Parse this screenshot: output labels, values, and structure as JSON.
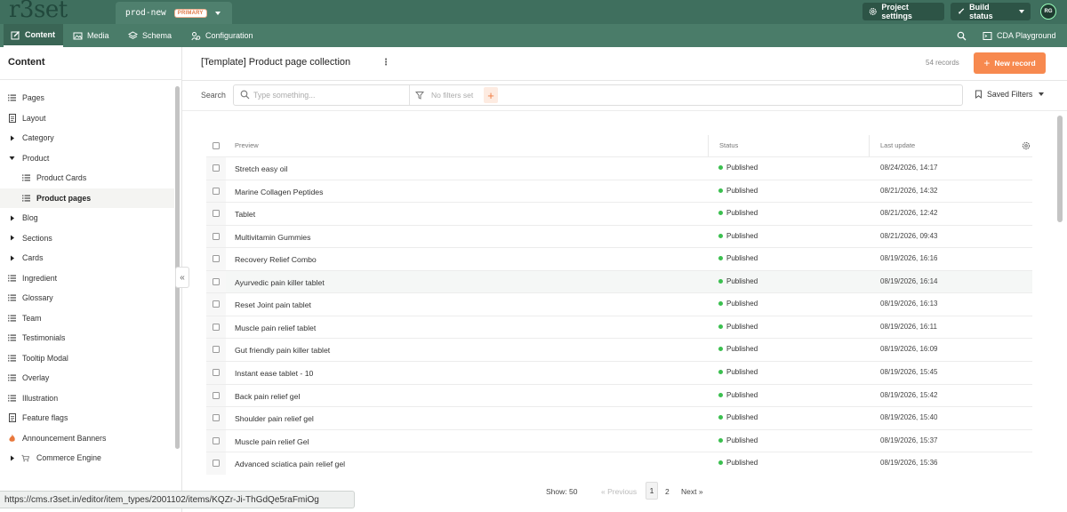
{
  "topbar": {
    "logo": "r3set",
    "environment": "prod-new",
    "environment_badge": "PRIMARY",
    "project_settings": "Project settings",
    "build_status": "Build status",
    "avatar_initials": "RG"
  },
  "nav": {
    "content": "Content",
    "media": "Media",
    "schema": "Schema",
    "configuration": "Configuration",
    "cda_playground": "CDA Playground"
  },
  "sidebar": {
    "title": "Content",
    "items": [
      {
        "label": "Pages",
        "icon": "list-icon",
        "indent": 0
      },
      {
        "label": "Layout",
        "icon": "document-icon",
        "indent": 0
      },
      {
        "label": "Category",
        "icon": "caret-right-icon",
        "indent": 0
      },
      {
        "label": "Product",
        "icon": "caret-down-icon",
        "indent": 0
      },
      {
        "label": "Product Cards",
        "icon": "list-icon",
        "indent": 1
      },
      {
        "label": "Product pages",
        "icon": "list-icon",
        "indent": 1,
        "active": true
      },
      {
        "label": "Blog",
        "icon": "caret-right-icon",
        "indent": 0
      },
      {
        "label": "Sections",
        "icon": "caret-right-icon",
        "indent": 0
      },
      {
        "label": "Cards",
        "icon": "caret-right-icon",
        "indent": 0
      },
      {
        "label": "Ingredient",
        "icon": "list-icon",
        "indent": 0
      },
      {
        "label": "Glossary",
        "icon": "list-icon",
        "indent": 0
      },
      {
        "label": "Team",
        "icon": "list-icon",
        "indent": 0
      },
      {
        "label": "Testimonials",
        "icon": "list-icon",
        "indent": 0
      },
      {
        "label": "Tooltip Modal",
        "icon": "list-icon",
        "indent": 0
      },
      {
        "label": "Overlay",
        "icon": "list-icon",
        "indent": 0
      },
      {
        "label": "Illustration",
        "icon": "list-icon",
        "indent": 0
      },
      {
        "label": "Feature flags",
        "icon": "document-icon",
        "indent": 0
      },
      {
        "label": "Announcement Banners",
        "icon": "flame-icon",
        "indent": 0
      },
      {
        "label": "Commerce Engine",
        "icon": "cart-icon",
        "indent": 0,
        "caret": true
      }
    ]
  },
  "main": {
    "title": "[Template] Product page collection",
    "records_count": "54 records",
    "new_record": "New record",
    "search_label": "Search",
    "search_placeholder": "Type something...",
    "no_filters": "No filters set",
    "saved_filters": "Saved Filters"
  },
  "table": {
    "columns": [
      "Preview",
      "Status",
      "Last update"
    ],
    "rows": [
      {
        "name": "Stretch easy oil",
        "status": "Published",
        "date": "08/24/2026, 14:17"
      },
      {
        "name": "Marine Collagen Peptides",
        "status": "Published",
        "date": "08/21/2026, 14:32"
      },
      {
        "name": "Tablet",
        "status": "Published",
        "date": "08/21/2026, 12:42"
      },
      {
        "name": "Multivitamin Gummies",
        "status": "Published",
        "date": "08/21/2026, 09:43"
      },
      {
        "name": "Recovery Relief Combo",
        "status": "Published",
        "date": "08/19/2026, 16:16"
      },
      {
        "name": "Ayurvedic pain killer tablet",
        "status": "Published",
        "date": "08/19/2026, 16:14"
      },
      {
        "name": "Reset Joint pain tablet",
        "status": "Published",
        "date": "08/19/2026, 16:13"
      },
      {
        "name": "Muscle pain relief tablet",
        "status": "Published",
        "date": "08/19/2026, 16:11"
      },
      {
        "name": "Gut friendly pain killer tablet",
        "status": "Published",
        "date": "08/19/2026, 16:09"
      },
      {
        "name": "Instant ease tablet - 10",
        "status": "Published",
        "date": "08/19/2026, 15:45"
      },
      {
        "name": "Back pain relief gel",
        "status": "Published",
        "date": "08/19/2026, 15:42"
      },
      {
        "name": "Shoulder pain relief gel",
        "status": "Published",
        "date": "08/19/2026, 15:40"
      },
      {
        "name": "Muscle pain relief Gel",
        "status": "Published",
        "date": "08/19/2026, 15:37"
      },
      {
        "name": "Advanced sciatica pain relief gel",
        "status": "Published",
        "date": "08/19/2026, 15:36"
      }
    ]
  },
  "pagination": {
    "show": "Show: 50",
    "previous": "« Previous",
    "page1": "1",
    "page2": "2",
    "next": "Next »"
  },
  "statusbar": {
    "url": "https://cms.r3set.in/editor/item_types/2001102/items/KQZr-Ji-ThGdQe5raFmiOg"
  },
  "colors": {
    "topbar": "#3f6f5e",
    "navbar": "#4a7c69",
    "accent": "#f7894f",
    "published": "#3bbf4f"
  }
}
